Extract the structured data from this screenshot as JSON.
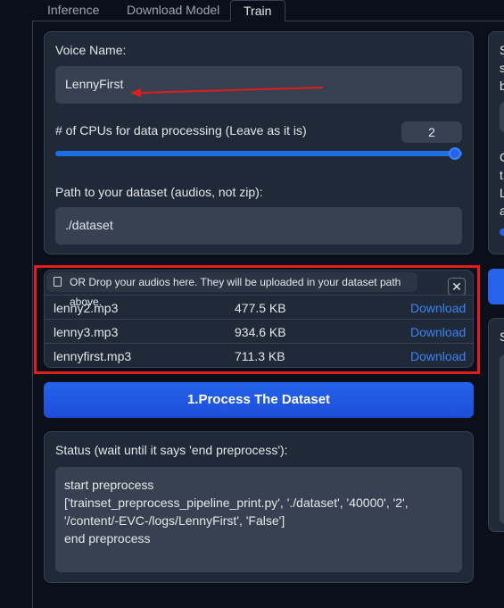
{
  "tabs": [
    {
      "label": "Inference"
    },
    {
      "label": "Download Model"
    },
    {
      "label": "Train"
    }
  ],
  "voice": {
    "label": "Voice Name:",
    "value": "LennyFirst"
  },
  "cpus": {
    "label": "# of CPUs for data processing (Leave as it is)",
    "value": "2"
  },
  "dataset": {
    "label": "Path to your dataset (audios, not zip):",
    "value": "./dataset"
  },
  "upload": {
    "hint": "OR Drop your audios here. They will be uploaded in your dataset path above.",
    "files": [
      {
        "name": "lenny2.mp3",
        "size": "477.5 KB",
        "action": "Download"
      },
      {
        "name": "lenny3.mp3",
        "size": "934.6 KB",
        "action": "Download"
      },
      {
        "name": "lennyfirst.mp3",
        "size": "711.3 KB",
        "action": "Download"
      }
    ]
  },
  "process_button": "1.Process The Dataset",
  "status": {
    "label": "Status (wait until it says 'end preprocess'):",
    "text": "start preprocess\n['trainset_preprocess_pipeline_print.py', './dataset', '40000', '2', '/content/-EVC-/logs/LennyFirst', 'False']\nend preprocess"
  },
  "right_column": {
    "letters": [
      "S",
      "s",
      "b",
      "C",
      "t",
      "L",
      "a",
      "S"
    ]
  },
  "colors": {
    "accent": "#2563eb",
    "link": "#3b82f6",
    "annotation_red": "#e11d1d",
    "panel": "#1f2937",
    "input": "#374151",
    "background": "#0b0f19"
  }
}
